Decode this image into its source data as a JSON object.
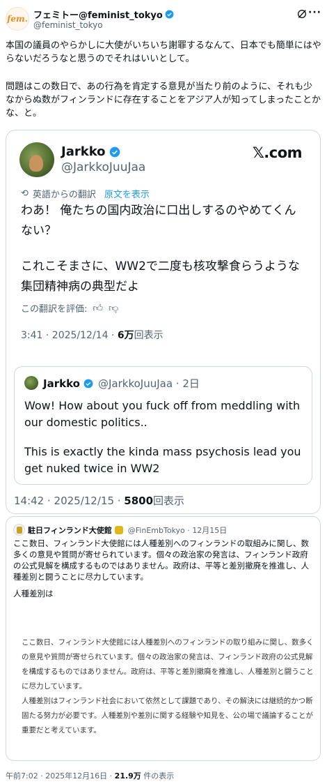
{
  "author": {
    "avatar_text": "fem.",
    "name": "フェミトー@feminist_tokyo",
    "handle": "@feminist_tokyo"
  },
  "post": {
    "paragraph1": "本国の議員のやらかしに大使がいちいち謝罪するなんて、日本でも簡単にはやらないだろうなと思うのでそれはいいとして。",
    "paragraph2": "問題はこの数日で、あの行為を肯定する意見が当たり前のように、それも少なからぬ数がフィンランドに存在することをアジア人が知ってしまったことかな、と。"
  },
  "card1": {
    "name": "Jarkko",
    "handle": "@JarkkoJuuJaa",
    "brand": "𝕏.com",
    "translation_label": "英語からの翻訳",
    "show_original": "原文を表示",
    "translated_1": "わあ！ 俺たちの国内政治に口出しするのやめてくんない？",
    "translated_2": "これこそまさに、WW2で二度も核攻撃食らうような集団精神病の典型だよ",
    "rate_label": "この翻訳を評価:",
    "time": "3:41 · 2025/12/14 · ",
    "views": "6万",
    "views_label": "回表示",
    "quote": {
      "name": "Jarkko",
      "handle": "@JarkkoJuuJaa · 2日",
      "text1": "Wow! How about you fuck off from meddling with our domestic politics..",
      "text2": "This is exactly the kinda mass psychosis lead you get nuked twice in WW2"
    },
    "outer_time": "14:42 · 2025/12/15 · ",
    "outer_views": "5800",
    "outer_views_label": "回表示"
  },
  "card2": {
    "name": "駐日フィンランド大使館",
    "handle": "@FinEmbTokyo · 12月15日",
    "text": "ここ数日、フィンランド大使館には人種差別へのフィンランドの取組みに関し、数多くの意見や質問が寄せられています。個々の政治家の発言は、フィンランド政府の公式見解を構成するものではありません。政府は、平等と差別撤廃を推進し、人種差別と闘うことに尽力しています。",
    "more": "人種差別は",
    "image_text_1": "ここ数日、フィンランド大使館には人種差別へのフィンランドの取り組みに関し、数多くの意見や質問が寄せられています。個々の政治家の発言は、フィンランド政府の公式見解を構成するものではありません。政府は、平等と差別撤廃を推進し、人種差別と闘うことに尽力しています。",
    "image_text_2": "人種差別はフィンランド社会において依然として課題であり、その解決には継続的かつ断固たる努力が必要です。人種差別や差別に関する経験や知見を、公の場で議論することが重要だと考えています。"
  },
  "footer": {
    "time": "午前7:02 · 2025年12月16日 · ",
    "views": "21.9万",
    "views_label": " 件の表示"
  }
}
